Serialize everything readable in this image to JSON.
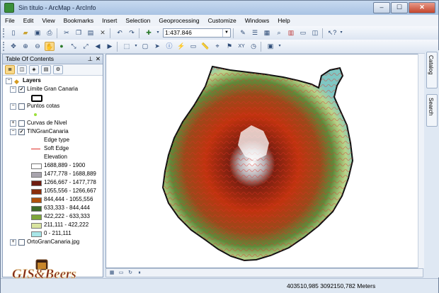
{
  "window": {
    "title": "Sin título - ArcMap - ArcInfo",
    "minimize": "–",
    "maximize": "☐",
    "close": "✕"
  },
  "menu": [
    "File",
    "Edit",
    "View",
    "Bookmarks",
    "Insert",
    "Selection",
    "Geoprocessing",
    "Customize",
    "Windows",
    "Help"
  ],
  "toolbar": {
    "scale": "1:437.846"
  },
  "toc": {
    "title": "Table Of Contents",
    "pin": "⊥",
    "close": "✕",
    "layers_label": "Layers",
    "items": [
      {
        "label": "Límite Gran Canaria",
        "checked": "✓"
      },
      {
        "label": "Puntos cotas",
        "checked": ""
      },
      {
        "label": "Curvas de Nivel",
        "checked": ""
      },
      {
        "label": "TINGranCanaria",
        "checked": "✓"
      }
    ],
    "edge_type_label": "Edge type",
    "soft_edge_label": "Soft Edge",
    "elevation_label": "Elevation",
    "elevation_classes": [
      {
        "label": "1688,889 - 1900",
        "color": "#ffffff"
      },
      {
        "label": "1477,778 - 1688,889",
        "color": "#a8a4ad"
      },
      {
        "label": "1266,667 - 1477,778",
        "color": "#6e1c10"
      },
      {
        "label": "1055,556 - 1266,667",
        "color": "#8a2e0c"
      },
      {
        "label": "844,444 - 1055,556",
        "color": "#b0500c"
      },
      {
        "label": "633,333 - 844,444",
        "color": "#3e6b2a"
      },
      {
        "label": "422,222 - 633,333",
        "color": "#7ea63a"
      },
      {
        "label": "211,111 - 422,222",
        "color": "#d9e4a0"
      },
      {
        "label": "0 - 211,111",
        "color": "#a8e6e8"
      }
    ],
    "orto_label": "OrtoGranCanaria.jpg"
  },
  "side_tabs": {
    "catalog": "Catalog",
    "search": "Search"
  },
  "status": {
    "coordinates": "403510,985  3092150,782 Meters"
  },
  "logo": {
    "text": "GIS&Beers"
  },
  "colors": {
    "titlebar": "#b8cfe9",
    "soft_edge": "#e0302a",
    "island_coast": "#6fb8b4"
  }
}
